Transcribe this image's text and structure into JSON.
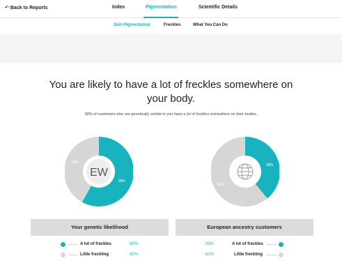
{
  "nav": {
    "back_label": "Back to Reports",
    "tabs": [
      {
        "label": "Index"
      },
      {
        "label": "Pigmentation"
      },
      {
        "label": "Scientific Details"
      }
    ]
  },
  "subnav": {
    "items": [
      {
        "label": "Skin Pigmentation"
      },
      {
        "label": "Freckles"
      },
      {
        "label": "What You Can Do"
      }
    ]
  },
  "main": {
    "headline": "You are likely to have a lot of freckles somewhere on your body.",
    "subtext": "58% of customers who are genetically similar to you have a lot of freckles somewhere on their bodies."
  },
  "donut_left": {
    "avatar_text": "EW",
    "teal_value": 58,
    "gray_value": 42,
    "teal_label": "58%",
    "gray_label": "42%"
  },
  "donut_right": {
    "teal_value": 39,
    "gray_value": 61,
    "teal_label": "39%",
    "gray_label": "61%"
  },
  "left_panel": {
    "title": "Your genetic likelihood",
    "rows": [
      {
        "label": "A lot of freckles",
        "pct": "58%"
      },
      {
        "label": "Little freckling",
        "pct": "42%"
      }
    ]
  },
  "right_panel": {
    "title": "European ancestry customers",
    "rows": [
      {
        "label": "A lot of freckles",
        "pct": "39%"
      },
      {
        "label": "Little freckling",
        "pct": "61%"
      }
    ]
  },
  "colors": {
    "teal": "#19b3c0",
    "gray": "#d6d6d6"
  }
}
